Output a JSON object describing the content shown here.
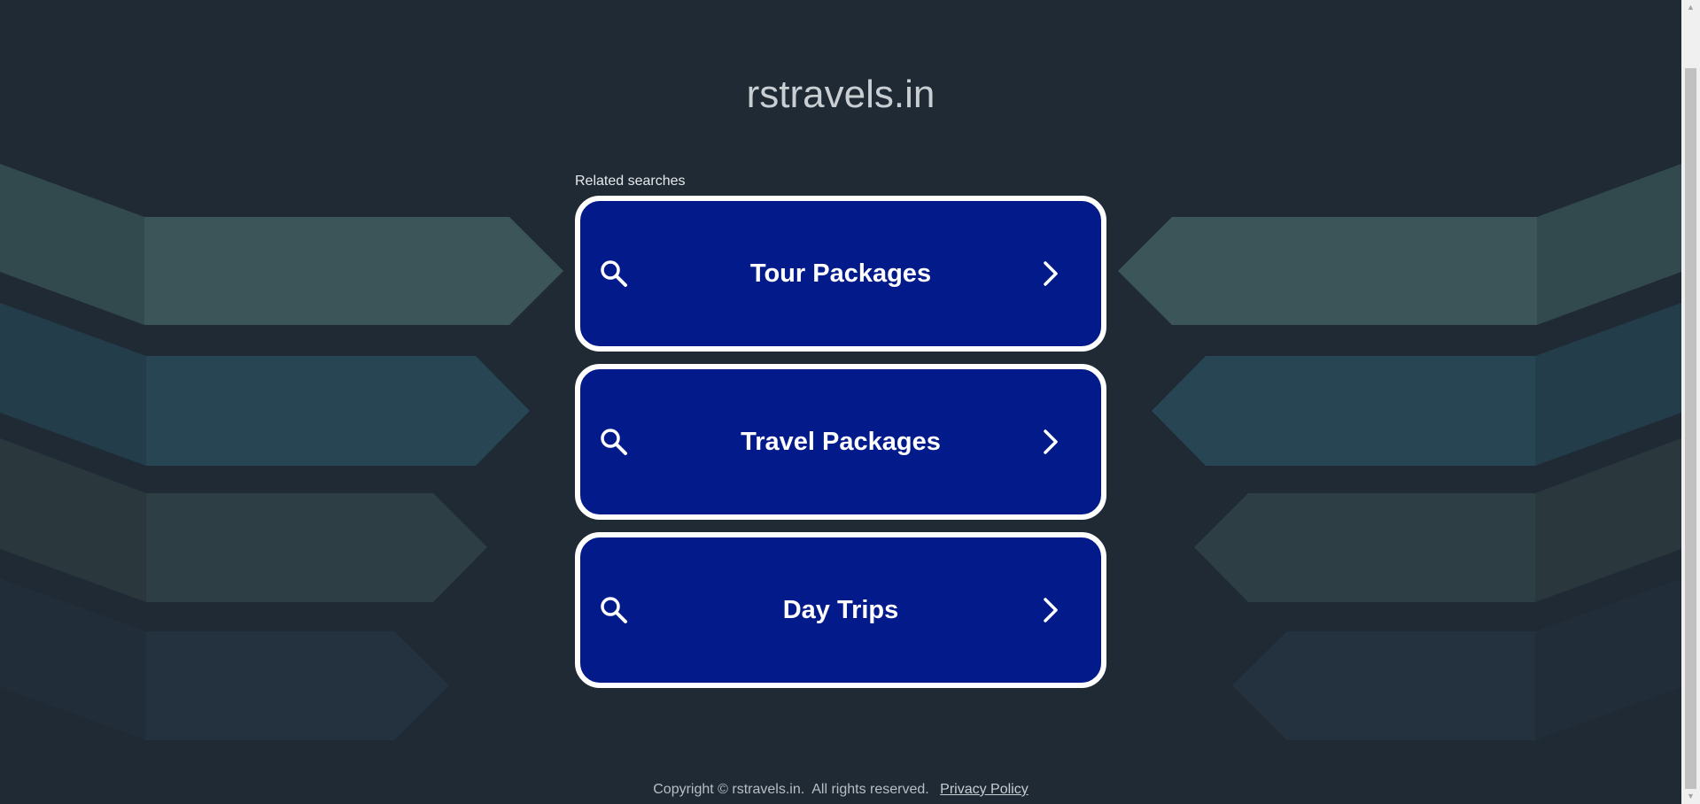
{
  "site": {
    "title": "rstravels.in"
  },
  "related": {
    "label": "Related searches",
    "items": [
      {
        "label": "Tour Packages"
      },
      {
        "label": "Travel Packages"
      },
      {
        "label": "Day Trips"
      }
    ]
  },
  "footer": {
    "copyright": "Copyright © rstravels.in.  All rights reserved.",
    "privacy_link": "Privacy Policy"
  },
  "scrollbar": {
    "up_arrow": "▲",
    "down_arrow": "▼"
  },
  "colors": {
    "background": "#1f2a35",
    "card_fill": "#021a8a",
    "card_border": "#ffffff",
    "band_1": "#3b5558",
    "band_2": "#274553",
    "band_3": "#2e3e45",
    "band_4": "#243240"
  },
  "icons": {
    "search": "search-icon",
    "arrow": "chevron-right-icon"
  }
}
